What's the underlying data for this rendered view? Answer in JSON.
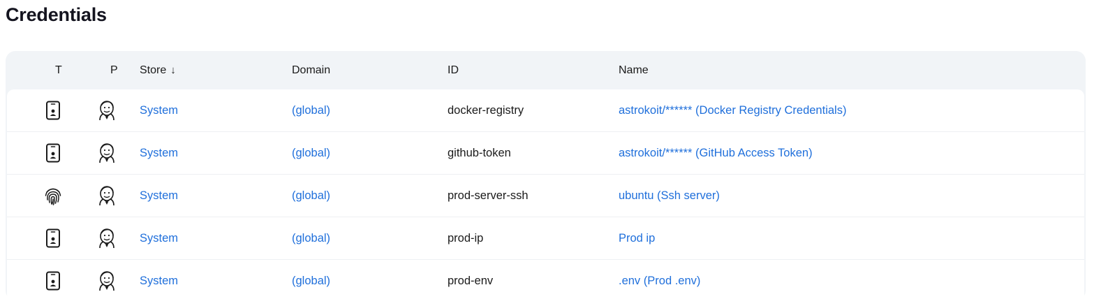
{
  "page": {
    "title": "Credentials"
  },
  "table": {
    "headers": {
      "type": "T",
      "provider": "P",
      "store": "Store",
      "store_sort_indicator": "↓",
      "domain": "Domain",
      "id": "ID",
      "name": "Name"
    },
    "rows": [
      {
        "type_icon": "phone-icon",
        "provider_icon": "jenkins-icon",
        "store": "System",
        "domain": "(global)",
        "id": "docker-registry",
        "name": "astrokoit/****** (Docker Registry Credentials)"
      },
      {
        "type_icon": "phone-icon",
        "provider_icon": "jenkins-icon",
        "store": "System",
        "domain": "(global)",
        "id": "github-token",
        "name": "astrokoit/****** (GitHub Access Token)"
      },
      {
        "type_icon": "fingerprint-icon",
        "provider_icon": "jenkins-icon",
        "store": "System",
        "domain": "(global)",
        "id": "prod-server-ssh",
        "name": "ubuntu (Ssh server)"
      },
      {
        "type_icon": "phone-icon",
        "provider_icon": "jenkins-icon",
        "store": "System",
        "domain": "(global)",
        "id": "prod-ip",
        "name": "Prod ip"
      },
      {
        "type_icon": "phone-icon",
        "provider_icon": "jenkins-icon",
        "store": "System",
        "domain": "(global)",
        "id": "prod-env",
        "name": ".env (Prod .env)"
      }
    ]
  },
  "colors": {
    "link": "#1f6fdb",
    "header_background": "#f1f4f7",
    "row_divider": "#eef0f3"
  }
}
